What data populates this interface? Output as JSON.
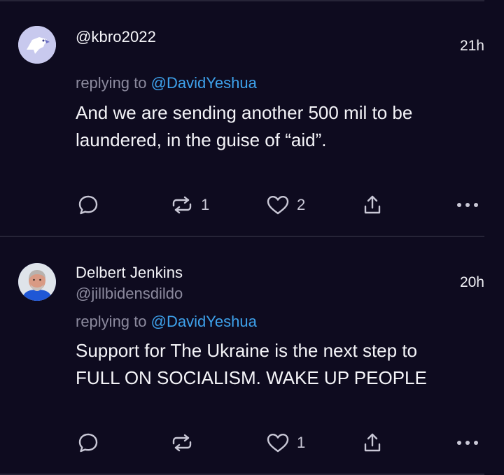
{
  "posts": [
    {
      "display_name": "@kbro2022",
      "handle": "",
      "time": "21h",
      "reply_prefix": "replying to ",
      "reply_to": "@DavidYeshua",
      "text_lines": [
        "And we are sending another 500 mil to be",
        "laundered, in the guise of “aid”."
      ],
      "repost_count": "1",
      "like_count": "2",
      "avatar": "eagle-avatar-icon"
    },
    {
      "display_name": "Delbert Jenkins",
      "handle": "@jillbidensdildo",
      "time": "20h",
      "reply_prefix": "replying to ",
      "reply_to": "@DavidYeshua",
      "text_lines": [
        "Support for The Ukraine is the next step to",
        "FULL ON SOCIALISM. WAKE UP PEOPLE"
      ],
      "repost_count": "",
      "like_count": "1",
      "avatar": "profile-photo"
    }
  ],
  "colors": {
    "background": "#0e0b1f",
    "mention": "#3ea2ec",
    "muted": "#8c8a9e",
    "divider": "#262437"
  }
}
